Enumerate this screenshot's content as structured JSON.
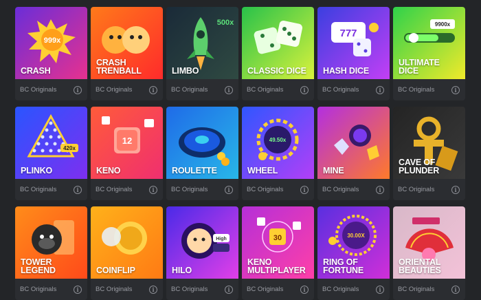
{
  "games": [
    {
      "title": "CRASH",
      "provider": "BC Originals",
      "info": "i",
      "badge": "999x",
      "bg": [
        "#6a2dd8",
        "#e7318f"
      ],
      "art": "explosion"
    },
    {
      "title": "CRASH\nTRENBALL",
      "provider": "BC Originals",
      "info": "i",
      "badge": "",
      "bg": [
        "#ff7a1a",
        "#ff2b2b"
      ],
      "art": "doges"
    },
    {
      "title": "LIMBO",
      "provider": "BC Originals",
      "info": "i",
      "badge": "500x",
      "bg": [
        "#1a2a38",
        "#2f4a42"
      ],
      "art": "rocket"
    },
    {
      "title": "CLASSIC DICE",
      "provider": "BC Originals",
      "info": "i",
      "badge": "",
      "bg": [
        "#28c24a",
        "#d9f23c"
      ],
      "art": "dice"
    },
    {
      "title": "HASH DICE",
      "provider": "BC Originals",
      "info": "i",
      "badge": "",
      "bg": [
        "#3b3fe0",
        "#c23ff5"
      ],
      "art": "slot"
    },
    {
      "title": "ULTIMATE\nDICE",
      "provider": "BC Originals",
      "info": "i",
      "badge": "9900x",
      "bg": [
        "#2fd24a",
        "#f0ea2a"
      ],
      "art": "slider"
    },
    {
      "title": "PLINKO",
      "provider": "BC Originals",
      "info": "i",
      "badge": "420x",
      "bg": [
        "#2a55ff",
        "#7d2ff0"
      ],
      "art": "plinko"
    },
    {
      "title": "KENO",
      "provider": "BC Originals",
      "info": "i",
      "badge": "12",
      "bg": [
        "#ff5b3a",
        "#f02f6f"
      ],
      "art": "keno"
    },
    {
      "title": "ROULETTE",
      "provider": "BC Originals",
      "info": "i",
      "badge": "",
      "bg": [
        "#1f6be8",
        "#28b7e8"
      ],
      "art": "roulette"
    },
    {
      "title": "WHEEL",
      "provider": "BC Originals",
      "info": "i",
      "badge": "49.50x",
      "bg": [
        "#2f56ff",
        "#b33ff7"
      ],
      "art": "wheel"
    },
    {
      "title": "MINE",
      "provider": "BC Originals",
      "info": "i",
      "badge": "",
      "bg": [
        "#b32fe0",
        "#ff7a2a"
      ],
      "art": "mine"
    },
    {
      "title": "CAVE OF\nPLUNDER",
      "provider": "BC Originals",
      "info": "i",
      "badge": "",
      "bg": [
        "#242424",
        "#3a3a3a"
      ],
      "art": "ankh"
    },
    {
      "title": "TOWER\nLEGEND",
      "provider": "BC Originals",
      "info": "i",
      "badge": "",
      "bg": [
        "#ff8c1a",
        "#ff4a1a"
      ],
      "art": "gorilla"
    },
    {
      "title": "COINFLIP",
      "provider": "BC Originals",
      "info": "i",
      "badge": "",
      "bg": [
        "#ffb11a",
        "#ff7a14"
      ],
      "art": "coin"
    },
    {
      "title": "HILO",
      "provider": "BC Originals",
      "info": "i",
      "badge": "High",
      "bg": [
        "#4a2ae8",
        "#e23fe8"
      ],
      "art": "hilo"
    },
    {
      "title": "KENO\nMULTIPLAYER",
      "provider": "BC Originals",
      "info": "i",
      "badge": "30",
      "bg": [
        "#b52fd8",
        "#ff3fa8"
      ],
      "art": "kenomp"
    },
    {
      "title": "RING OF\nFORTUNE",
      "provider": "BC Originals",
      "info": "i",
      "badge": "30.00X",
      "bg": [
        "#5a2fe0",
        "#d02fd8"
      ],
      "art": "ring"
    },
    {
      "title": "ORIENTAL\nBEAUTIES",
      "provider": "BC Originals",
      "info": "i",
      "badge": "",
      "bg": [
        "#d8b8c8",
        "#f3c2d8"
      ],
      "art": "fan"
    }
  ]
}
